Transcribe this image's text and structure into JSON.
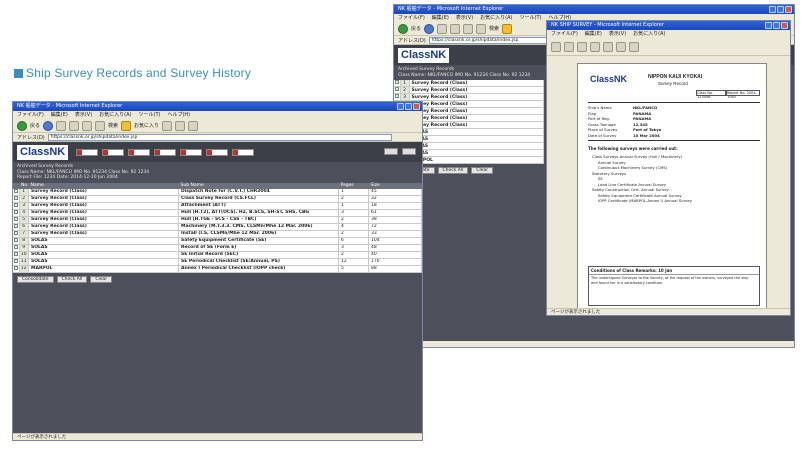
{
  "caption": "Ship Survey Records and Survey History",
  "browser": {
    "title": "NK 船舶データ - Microsoft Internet Explorer",
    "menu": [
      "ファイル(F)",
      "編集(E)",
      "表示(V)",
      "お気に入り(A)",
      "ツール(T)",
      "ヘルプ(H)"
    ],
    "back_label": "戻る",
    "search_label": "検索",
    "favorites_label": "お気に入り",
    "address_label": "アドレス(D)",
    "address_value": "https://classnk.or.jp/shipdata/index.jsp",
    "status": "ページが表示されました"
  },
  "app": {
    "logo": "ClassNK",
    "subtitle": "Sattions  -  Ship Survey Records",
    "section_title": "Archived Survey Records",
    "info_line": "Class Name: NKL/FANCO  IMO No. 91234  Class No. 92 1234",
    "info_line2": "Report File:  1234 Date: 2014-12-10  Jun 2004",
    "print_label": "Print",
    "close_label": "Close",
    "columns": [
      "No.",
      "Name",
      "Sub Name",
      "Pages",
      "Size"
    ],
    "rows": [
      {
        "no": "1",
        "name": "Survey Record (Class)",
        "sub": "Dispatch Note for  (C.V.T.) CHR3004",
        "p": "1",
        "s": "45"
      },
      {
        "no": "2",
        "name": "Survey Record (Class)",
        "sub": "Class Survey Record (CS.FCL)",
        "p": "2",
        "s": "32"
      },
      {
        "no": "3",
        "name": "Survey Record (Class)",
        "sub": "Attachment (ATT)",
        "p": "1",
        "s": "18"
      },
      {
        "no": "4",
        "name": "Survey Record (Class)",
        "sub": "Hull (H.T2), ATT(OCS). H2, B.SCS, SH-ST, SHS, CBG",
        "p": "3",
        "s": "61"
      },
      {
        "no": "5",
        "name": "Survey Record (Class)",
        "sub": "Hull (H.TGE - SCS - CSS - TBC)",
        "p": "2",
        "s": "38"
      },
      {
        "no": "6",
        "name": "Survey Record (Class)",
        "sub": "Machinery (M.T.3.3. CMS, CLSMn/Mhe 12 Mar. 2006)",
        "p": "4",
        "s": "72"
      },
      {
        "no": "7",
        "name": "Survey Record (Class)",
        "sub": "Install (I.S, CLSMn/Mhe 12 Mar. 2006)",
        "p": "2",
        "s": "33"
      },
      {
        "no": "8",
        "name": "SOLAS",
        "sub": "Safety Equipment Certificate (SE)",
        "p": "6",
        "s": "104"
      },
      {
        "no": "9",
        "name": "SOLAS",
        "sub": "Record of SE (Form E)",
        "p": "3",
        "s": "48"
      },
      {
        "no": "10",
        "name": "SOLAS",
        "sub": "SE Initial Record (SEC)",
        "p": "2",
        "s": "40"
      },
      {
        "no": "11",
        "name": "SOLAS",
        "sub": "SE Periodical Checklist (SE/Annual, PS)",
        "p": "12",
        "s": "176"
      },
      {
        "no": "12",
        "name": "MARPOL",
        "sub": "Annex I Periodical Checklist (IOPP check)",
        "p": "5",
        "s": "88"
      }
    ],
    "bottom_buttons": [
      "Consolidate",
      "Check All",
      "Clear"
    ]
  },
  "report": {
    "window_title": "NK SHIP SURVEY - Microsoft Internet Explorer",
    "org": "NIPPON KAIJI KYOKAI",
    "doc_title": "Survey Record",
    "logo": "ClassNK",
    "box1": "Class No. 123456",
    "box2": "Report No. 2004-1083",
    "fields": [
      {
        "k": "Ship's Name",
        "v": "NKL/FANCO"
      },
      {
        "k": "Flag",
        "v": "PANAMA"
      },
      {
        "k": "Port of Reg.",
        "v": "PANAMA"
      },
      {
        "k": "Gross Tonnage",
        "v": "12,345"
      },
      {
        "k": "Place of Survey",
        "v": "Port of Tokyo"
      },
      {
        "k": "Date of Survey",
        "v": "10 Mar 2004"
      }
    ],
    "section": "The following surveys were carried out:",
    "items": [
      "Class Surveys  Annual Survey (Hull / Machinery)",
      "Annual Survey",
      "Continuous Machinery Survey (CMS)",
      "Statutory Surveys",
      "SE",
      "Load Line Certificate Annual Survey",
      "Safety Construction Cert. Annual Survey",
      "Safety Equipment Certificate Annual Survey",
      "IOPP Certificate (MARPOL Annex I) Annual Survey"
    ],
    "footer_section": "Conditions of Class Remarks: 10 Jan",
    "footer_lines": [
      "The undersigned Surveyor to the Society, at the request of the owners, surveyed the ship",
      "and found her in a satisfactory condition."
    ],
    "status": "ページが表示されました"
  },
  "back_rows": [
    "Survey Record (Class)",
    "Survey Record (Class)",
    "Survey Record (Class)",
    "Survey Record (Class)",
    "Survey Record (Class)",
    "Survey Record (Class)",
    "Survey Record (Class)",
    "SOLAS",
    "SOLAS",
    "SOLAS",
    "SOLAS",
    "MARPOL"
  ]
}
